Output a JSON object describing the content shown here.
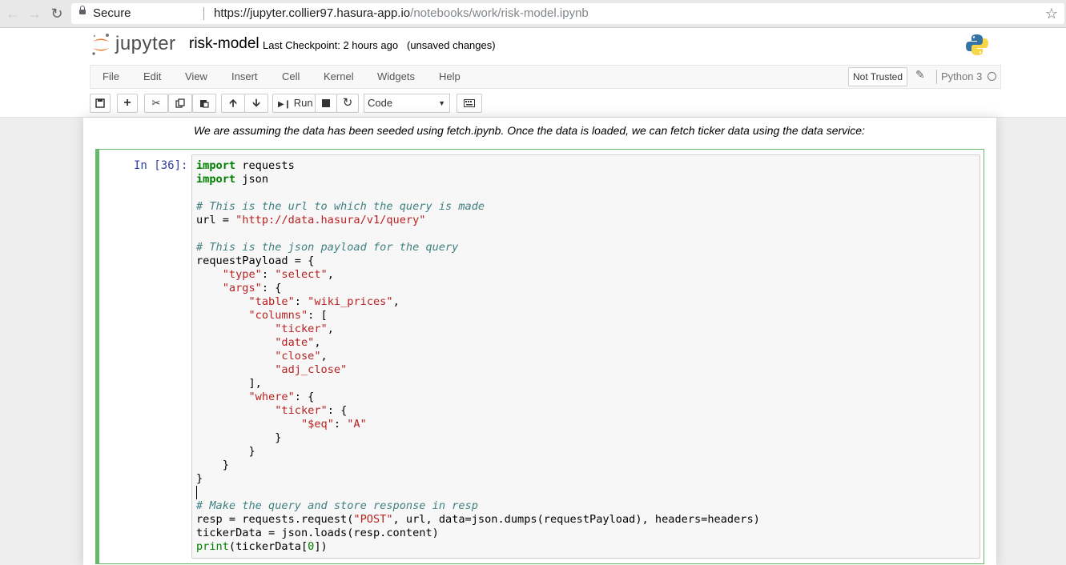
{
  "browser": {
    "secure_label": "Secure",
    "url_host": "https://jupyter.collier97.hasura-app.io",
    "url_path": "/notebooks/work/risk-model.ipynb"
  },
  "header": {
    "logo_text": "jupyter",
    "notebook_name": "risk-model",
    "checkpoint": "Last Checkpoint: 2 hours ago",
    "autosave": "(unsaved changes)"
  },
  "menubar": {
    "items": [
      "File",
      "Edit",
      "View",
      "Insert",
      "Cell",
      "Kernel",
      "Widgets",
      "Help"
    ],
    "trusted_label": "Not Trusted",
    "kernel_name": "Python 3"
  },
  "toolbar": {
    "run_label": "Run",
    "cell_type": "Code"
  },
  "notebook": {
    "markdown_text": "We are assuming the data has been seeded using fetch.ipynb. Once the data is loaded, we can fetch ticker data using the data service:",
    "cell_prompt": "In [36]:",
    "code_lines": [
      "import requests",
      "import json",
      "",
      "# This is the url to which the query is made",
      "url = \"http://data.hasura/v1/query\"",
      "",
      "# This is the json payload for the query",
      "requestPayload = {",
      "    \"type\": \"select\",",
      "    \"args\": {",
      "        \"table\": \"wiki_prices\",",
      "        \"columns\": [",
      "            \"ticker\",",
      "            \"date\",",
      "            \"close\",",
      "            \"adj_close\"",
      "        ],",
      "        \"where\": {",
      "            \"ticker\": {",
      "                \"$eq\": \"A\"",
      "            }",
      "        }",
      "    }",
      "}",
      "",
      "# Make the query and store response in resp",
      "resp = requests.request(\"POST\", url, data=json.dumps(requestPayload), headers=headers)",
      "tickerData = json.loads(resp.content)",
      "print(tickerData[0])"
    ]
  },
  "icons": [
    "back-icon",
    "forward-icon",
    "reload-icon",
    "lock-icon",
    "star-icon",
    "python-logo",
    "pencil-icon",
    "kernel-idle-icon"
  ]
}
